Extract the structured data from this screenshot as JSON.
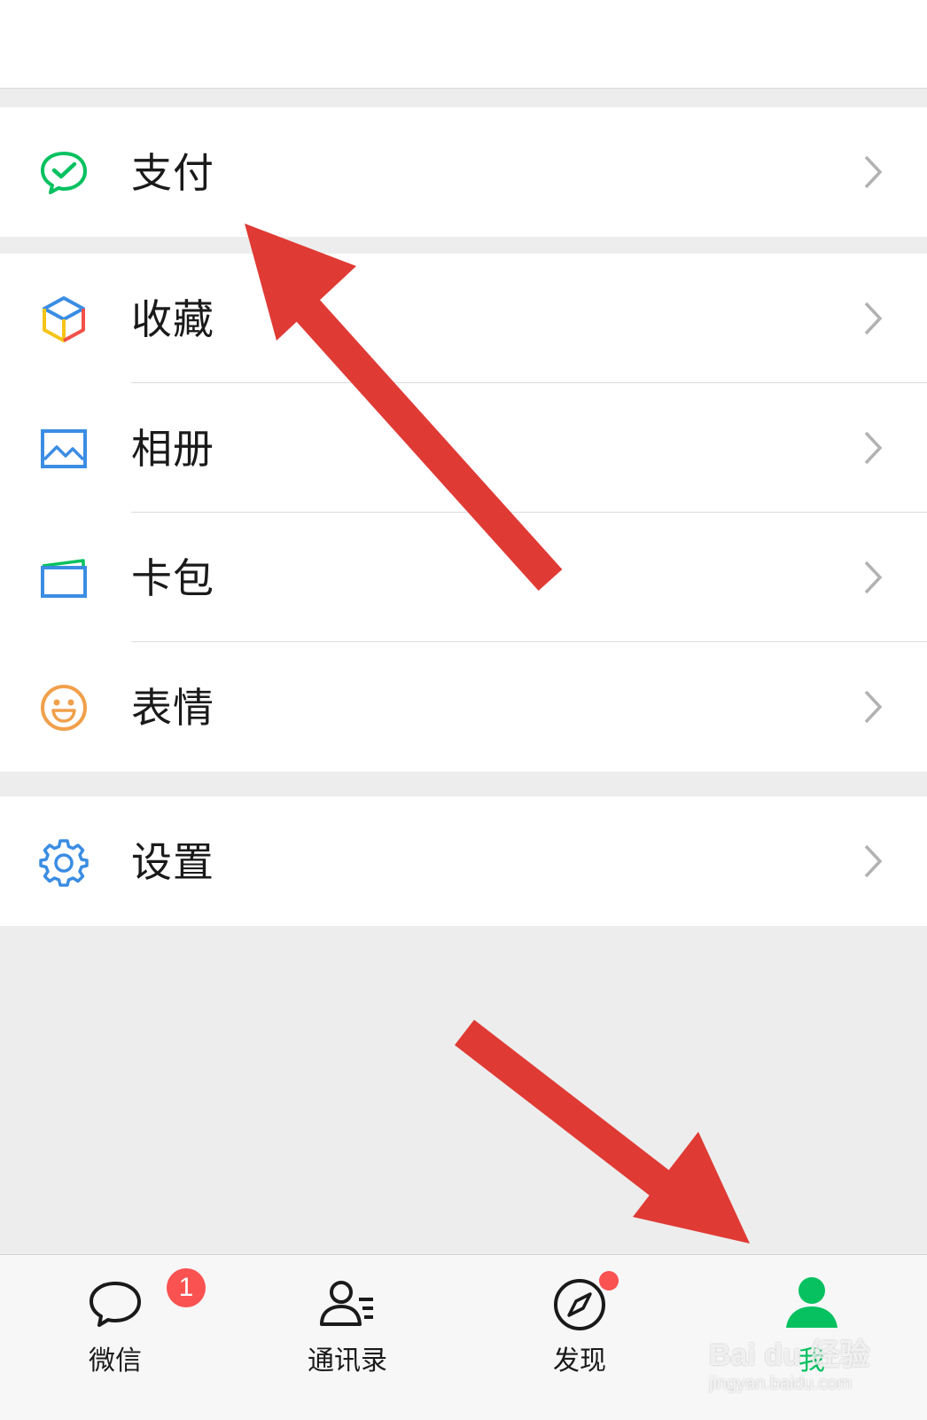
{
  "menu": {
    "pay": {
      "label": "支付",
      "icon": "wechat-pay-icon"
    },
    "favorites": {
      "label": "收藏",
      "icon": "cube-icon"
    },
    "album": {
      "label": "相册",
      "icon": "picture-icon"
    },
    "cards": {
      "label": "卡包",
      "icon": "wallet-card-icon"
    },
    "stickers": {
      "label": "表情",
      "icon": "smiley-icon"
    },
    "settings": {
      "label": "设置",
      "icon": "gear-icon"
    }
  },
  "tabbar": {
    "chats": {
      "label": "微信",
      "badge": "1",
      "icon": "chat-bubble-icon"
    },
    "contacts": {
      "label": "通讯录",
      "icon": "contacts-icon"
    },
    "discover": {
      "label": "发现",
      "icon": "compass-icon"
    },
    "me": {
      "label": "我",
      "icon": "person-icon"
    }
  },
  "watermark": {
    "brand": "Bai du 经验",
    "url": "jingyan.baidu.com"
  },
  "colors": {
    "accent_green": "#07c160",
    "badge_red": "#fa5151",
    "arrow_red": "#e03a34",
    "background": "#ededed"
  }
}
